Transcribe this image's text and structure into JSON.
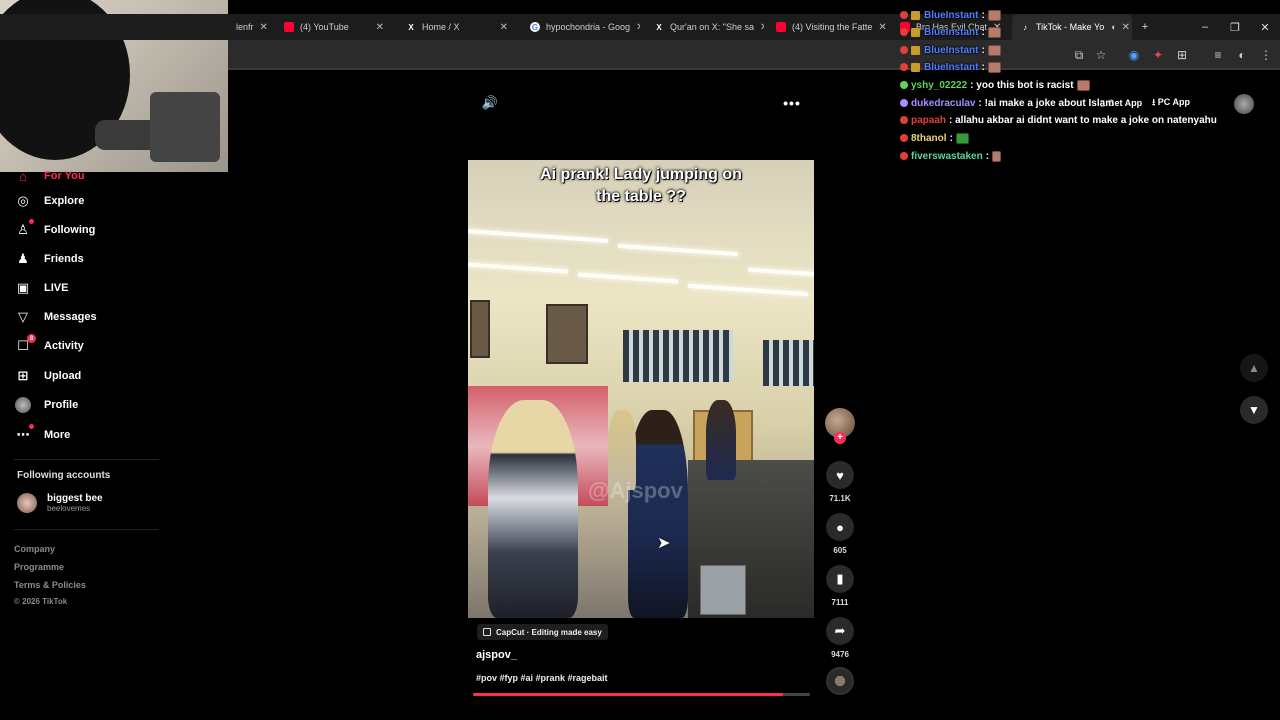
{
  "browser": {
    "tabs": [
      {
        "label": "(4) YouTube"
      },
      {
        "label": "Home / X"
      },
      {
        "label": "hypochondria - Goog"
      },
      {
        "label": "Qur'an on X: \"She sa"
      },
      {
        "label": "(4) Visiting the Fatte"
      },
      {
        "label": "Bro Has Evil Chat"
      },
      {
        "label": "TikTok - Make Yo"
      }
    ],
    "new_tab": "+",
    "minimize": "–",
    "restore": "❐",
    "close": "✕",
    "partial_tab": "lenfr"
  },
  "sidebar": {
    "items": [
      {
        "label": "For You"
      },
      {
        "label": "Explore"
      },
      {
        "label": "Following"
      },
      {
        "label": "Friends"
      },
      {
        "label": "LIVE"
      },
      {
        "label": "Messages"
      },
      {
        "label": "Activity",
        "badge": "8"
      },
      {
        "label": "Upload"
      },
      {
        "label": "Profile"
      },
      {
        "label": "More"
      }
    ],
    "following_title": "Following accounts",
    "account": {
      "name": "biggest bee",
      "handle": "beelovemes"
    },
    "footer": [
      "Company",
      "Programme",
      "Terms & Policies",
      "© 2026 TikTok"
    ]
  },
  "video": {
    "overlay_title_line1": "Ai prank! Lady jumping on",
    "overlay_title_line2": "the table ??",
    "watermark": "@Ajspov",
    "capcut": "CapCut · Editing made easy",
    "author": "ajspov_",
    "tags": "#pov #fyp #ai #prank #ragebait",
    "progress": 0.92
  },
  "actions": {
    "likes": "71.1K",
    "comments": "605",
    "saves": "7111",
    "shares": "9476"
  },
  "top_right": {
    "get_app": "Get App",
    "pc_app": "PC App"
  },
  "chat": [
    {
      "user": "BlueInstant",
      "msg": ":",
      "color": "#4f7dff"
    },
    {
      "user": "BlueInstant",
      "msg": ":",
      "color": "#4f7dff"
    },
    {
      "user": "BlueInstant",
      "msg": ":",
      "color": "#4f7dff"
    },
    {
      "user": "BlueInstant",
      "msg": ":",
      "color": "#4f7dff"
    },
    {
      "user": "yshy_02222",
      "msg": ": yoo this bot is racist",
      "color": "#5fd35f"
    },
    {
      "user": "dukedraculav",
      "msg": ": !ai make a joke about Islam",
      "color": "#a98cff"
    },
    {
      "user": "papaah",
      "msg": ": allahu akbar ai didnt want to make a joke on natenyahu",
      "color": "#e0403a"
    },
    {
      "user": "8thanol",
      "msg": ":",
      "color": "#f0d080"
    },
    {
      "user": "fiverswastaken",
      "msg": ":",
      "color": "#5fd3a0"
    }
  ],
  "colors": {
    "accent": "#fe2c55",
    "background": "#000000"
  }
}
